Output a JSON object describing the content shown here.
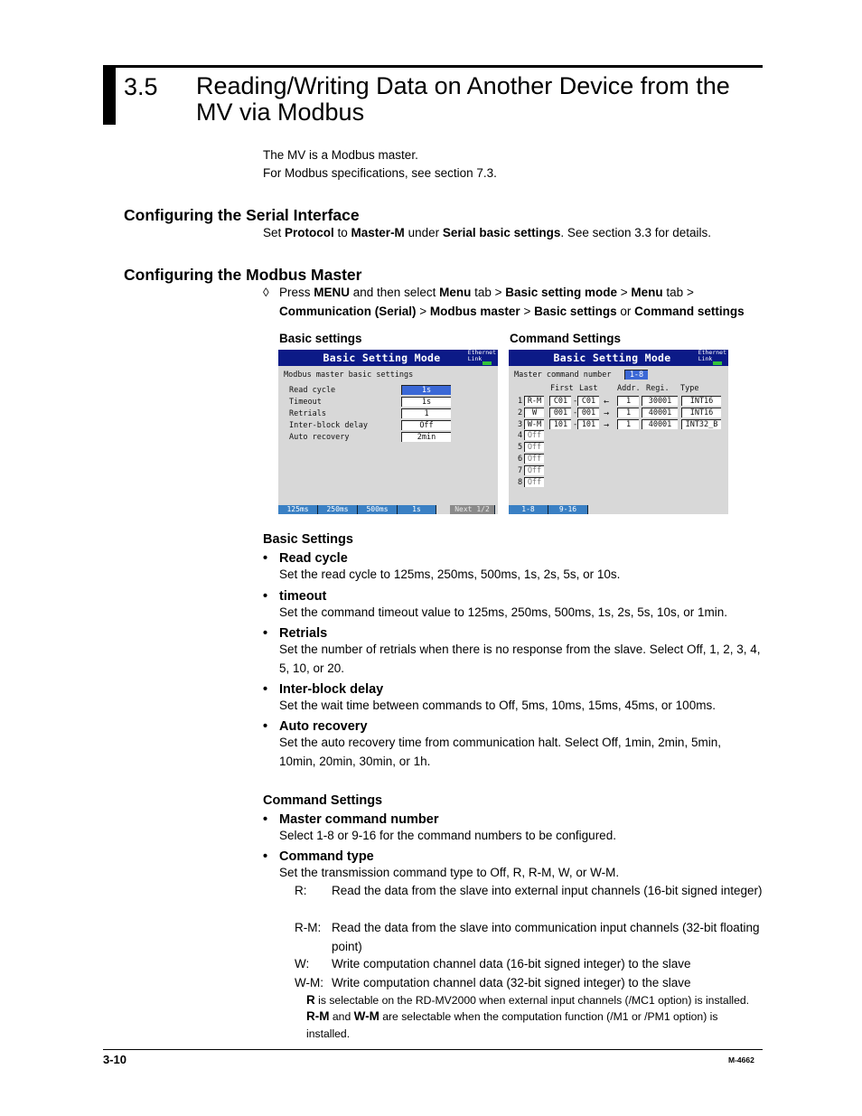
{
  "section": {
    "number": "3.5",
    "title": "Reading/Writing Data on Another Device from the MV via Modbus"
  },
  "intro": [
    "The MV is a Modbus master.",
    "For Modbus specifications, see section 7.3."
  ],
  "serial_interface": {
    "heading": "Configuring the Serial Interface",
    "text": {
      "t1": "Set ",
      "b1": "Protocol",
      "t2": " to ",
      "b2": "Master-M",
      "t3": " under ",
      "b3": "Serial basic settings",
      "t4": ". See section 3.3 for details."
    }
  },
  "modbus_master": {
    "heading": "Configuring the Modbus Master",
    "procedure_symbol": "◊",
    "line1": {
      "t1": "Press ",
      "b1": "MENU",
      "t2": " and then select ",
      "b2": "Menu",
      "t3": " tab > ",
      "b3": "Basic setting mode",
      "t4": " > ",
      "b4": "Menu",
      "t5": " tab >"
    },
    "line2": {
      "b1": "Communication (Serial)",
      "t1": " > ",
      "b2": "Modbus master",
      "t2": " > ",
      "b3": "Basic settings",
      "t3": " or ",
      "b4": "Command settings"
    },
    "caption_basic": "Basic settings",
    "caption_command": "Command Settings"
  },
  "screen_basic": {
    "title": "Basic Setting Mode",
    "eth_line1": "Ethernet",
    "eth_line2": "Link",
    "subtitle": "Modbus master basic settings",
    "rows": [
      {
        "label": "Read cycle",
        "value": "1s",
        "selected": true
      },
      {
        "label": "Timeout",
        "value": "1s"
      },
      {
        "label": "Retrials",
        "value": "1"
      },
      {
        "label": "Inter-block delay",
        "value": "Off"
      },
      {
        "label": "Auto recovery",
        "value": "2min"
      }
    ],
    "softkeys": [
      "125ms",
      "250ms",
      "500ms",
      "1s",
      "Next 1/2"
    ]
  },
  "screen_command": {
    "title": "Basic Setting Mode",
    "eth_line1": "Ethernet",
    "eth_line2": "Link",
    "master_cmd_label": "Master command number",
    "master_cmd_value": "1-8",
    "headers": {
      "first": "First",
      "last": "Last",
      "addr": "Addr.",
      "regi": "Regi.",
      "type": "Type"
    },
    "rows": [
      {
        "num": "1",
        "cmd": "R-M",
        "first": "C01",
        "last": "C01",
        "dir": "←",
        "addr": "1",
        "regi": "30001",
        "type": "INT16"
      },
      {
        "num": "2",
        "cmd": "W",
        "first": "001",
        "last": "001",
        "dir": "→",
        "addr": "1",
        "regi": "40001",
        "type": "INT16"
      },
      {
        "num": "3",
        "cmd": "W-M",
        "first": "101",
        "last": "101",
        "dir": "→",
        "addr": "1",
        "regi": "40001",
        "type": "INT32_B"
      },
      {
        "num": "4",
        "cmd": "Off"
      },
      {
        "num": "5",
        "cmd": "Off"
      },
      {
        "num": "6",
        "cmd": "Off"
      },
      {
        "num": "7",
        "cmd": "Off"
      },
      {
        "num": "8",
        "cmd": "Off"
      }
    ],
    "softkeys": [
      "1-8",
      "9-16"
    ]
  },
  "basic_settings": {
    "heading": "Basic Settings",
    "items": [
      {
        "title": "Read cycle",
        "desc": "Set the read cycle to 125ms, 250ms, 500ms, 1s, 2s, 5s, or 10s."
      },
      {
        "title": "timeout",
        "desc": "Set the command timeout value to 125ms, 250ms, 500ms, 1s, 2s, 5s, 10s, or 1min."
      },
      {
        "title": "Retrials",
        "desc": "Set the number of retrials when there is no response from the slave. Select Off, 1, 2, 3, 4, 5, 10, or 20."
      },
      {
        "title": "Inter-block delay",
        "desc": "Set the wait time between commands to Off, 5ms, 10ms, 15ms, 45ms, or 100ms."
      },
      {
        "title": "Auto recovery",
        "desc": "Set the auto recovery time from communication halt. Select Off, 1min, 2min, 5min, 10min, 20min, 30min, or 1h."
      }
    ]
  },
  "command_settings": {
    "heading": "Command Settings",
    "items": [
      {
        "title": "Master command number",
        "desc": "Select 1-8 or 9-16 for the command numbers to be configured."
      },
      {
        "title": "Command type",
        "desc": "Set the transmission command type to Off, R, R-M, W, or W-M."
      }
    ],
    "definitions": [
      {
        "key": "R:",
        "value": "Read the data from the slave into external input channels (16-bit signed integer)"
      },
      {
        "key": "R-M:",
        "value": "Read the data from the slave into communication input channels (32-bit floating point)"
      },
      {
        "key": "W:",
        "value": "Write computation channel data (16-bit signed integer) to the slave"
      },
      {
        "key": "W-M:",
        "value": "Write computation channel data (32-bit signed integer) to the slave"
      }
    ],
    "note1": {
      "b1": "R",
      "t1": " is selectable on the RD-MV2000 when external input channels (/MC1 option) is installed."
    },
    "note2": {
      "b1": "R-M",
      "t1": " and ",
      "b2": "W-M",
      "t2": " are selectable when the computation function (/M1 or /PM1 option) is installed."
    }
  },
  "footer": {
    "page_number": "3-10",
    "doc_id": "M-4662"
  }
}
